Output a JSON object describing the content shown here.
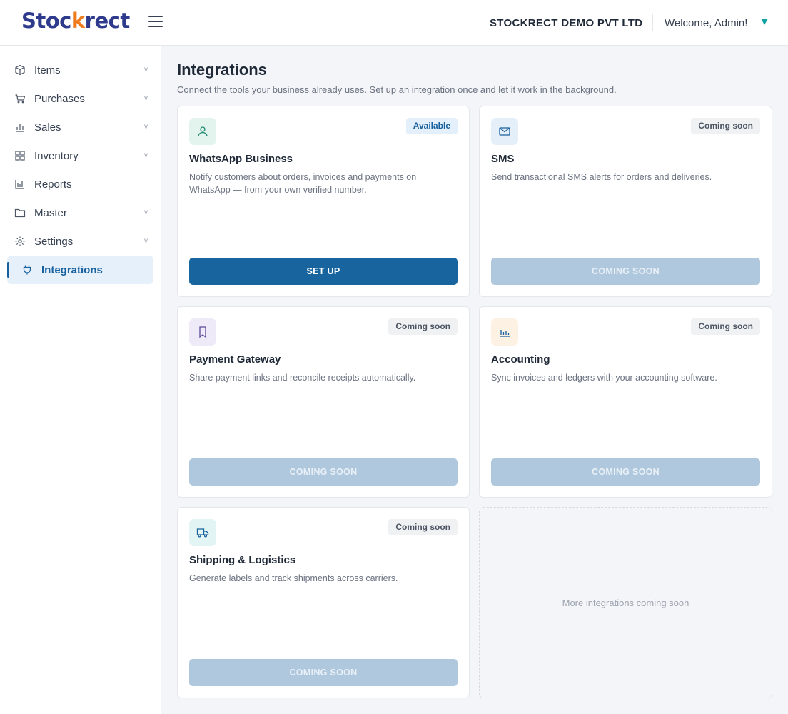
{
  "header": {
    "logo": {
      "prefix": "Stoc",
      "check": "k",
      "suffix": "rect"
    },
    "company": "STOCKRECT DEMO PVT LTD",
    "welcome": "Welcome, Admin!"
  },
  "sidebar": {
    "items": [
      {
        "label": "Items",
        "icon": "box-icon",
        "has_chevron": true
      },
      {
        "label": "Purchases",
        "icon": "cart-icon",
        "has_chevron": true
      },
      {
        "label": "Sales",
        "icon": "bar-chart-icon",
        "has_chevron": true
      },
      {
        "label": "Inventory",
        "icon": "grid-icon",
        "has_chevron": true
      },
      {
        "label": "Reports",
        "icon": "reports-icon",
        "has_chevron": false
      },
      {
        "label": "Master",
        "icon": "folder-icon",
        "has_chevron": true
      },
      {
        "label": "Settings",
        "icon": "gear-icon",
        "has_chevron": true
      },
      {
        "label": "Integrations",
        "icon": "plug-icon",
        "has_chevron": false,
        "active": true
      }
    ],
    "chevron": "v"
  },
  "page": {
    "title": "Integrations",
    "subtitle": "Connect the tools your business already uses. Set up an integration once and let it work in the background."
  },
  "cards": [
    {
      "title": "WhatsApp Business",
      "description": "Notify customers about orders, invoices and payments on WhatsApp — from your own verified number.",
      "badge": "Available",
      "button": "SET UP",
      "icon": "user-icon",
      "icon_bg": "#e3f4ee",
      "icon_color": "#1f8a70"
    },
    {
      "title": "SMS",
      "description": "Send transactional SMS alerts for orders and deliveries.",
      "badge": "Coming soon",
      "button": "COMING SOON",
      "icon": "mail-icon",
      "icon_bg": "#e5effa",
      "icon_color": "#17609e"
    },
    {
      "title": "Payment Gateway",
      "description": "Share payment links and reconcile receipts automatically.",
      "badge": "Coming soon",
      "button": "COMING SOON",
      "icon": "bookmark-icon",
      "icon_bg": "#efeaf7",
      "icon_color": "#5b4b9a"
    },
    {
      "title": "Accounting",
      "description": "Sync invoices and ledgers with your accounting software.",
      "badge": "Coming soon",
      "button": "COMING SOON",
      "icon": "chart-icon",
      "icon_bg": "#fdf1e4",
      "icon_color": "#17609e"
    },
    {
      "title": "Shipping & Logistics",
      "description": "Generate labels and track shipments across carriers.",
      "badge": "Coming soon",
      "button": "COMING SOON",
      "icon": "truck-icon",
      "icon_bg": "#e2f4f3",
      "icon_color": "#17609e"
    }
  ],
  "placeholder": "More integrations coming soon",
  "colors": {
    "brand": "#2e3a8c",
    "accent": "#f07b1c",
    "primary_button": "#17649f",
    "disabled_button": "#afc8dd"
  }
}
